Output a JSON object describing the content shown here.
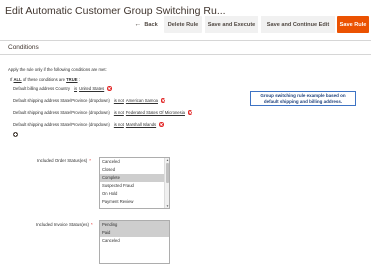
{
  "header": {
    "title": "Edit Automatic Customer Group Switching Ru..."
  },
  "toolbar": {
    "back_label": "Back",
    "delete_label": "Delete Rule",
    "save_execute_label": "Save and Execute",
    "save_continue_label": "Save and Continue Edit",
    "save_label": "Save Rule"
  },
  "section": {
    "title": "Conditions"
  },
  "conditions": {
    "intro": "Apply the rule only if the following conditions are met:",
    "root": {
      "prefix": "If",
      "aggregator": "ALL",
      "middle": "of these conditions are",
      "value": "TRUE",
      "suffix": ":"
    },
    "items": [
      {
        "label": "Default billing address Country",
        "operator": "is",
        "value": "United States"
      },
      {
        "label": "Default shipping address State/Province (dropdown)",
        "operator": "is not",
        "value": "American Samoa"
      },
      {
        "label": "Default shipping address State/Province (dropdown)",
        "operator": "is not",
        "value": "Federated States Of Micronesia"
      },
      {
        "label": "Default shipping address State/Province (dropdown)",
        "operator": "is not",
        "value": "Marshall Islands"
      }
    ]
  },
  "callout": {
    "line1": "Group switching rule example based on",
    "line2": "default shipping and billing address."
  },
  "order_status": {
    "label": "Included Order Status(es)",
    "required": "*",
    "options": [
      {
        "label": "Canceled",
        "selected": false
      },
      {
        "label": "Closed",
        "selected": false
      },
      {
        "label": "Complete",
        "selected": true
      },
      {
        "label": "Suspected Fraud",
        "selected": false
      },
      {
        "label": "On Hold",
        "selected": false
      },
      {
        "label": "Payment Review",
        "selected": false
      }
    ]
  },
  "invoice_status": {
    "label": "Included Invoice Status(es)",
    "required": "*",
    "options": [
      {
        "label": "Pending",
        "selected": true
      },
      {
        "label": "Paid",
        "selected": true
      },
      {
        "label": "Canceled",
        "selected": false
      }
    ]
  },
  "colors": {
    "primary_button": "#eb5202",
    "remove_icon": "#e22626",
    "callout_border": "#3d73c4"
  }
}
